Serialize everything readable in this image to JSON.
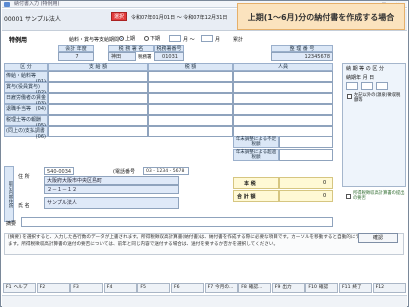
{
  "window": {
    "title": "納付書入力 (特例用)",
    "controls": "－ □ ×"
  },
  "header": {
    "company_name": "00001 サンプル法人",
    "change_button": "選択",
    "period_start": "令和07年01月01日",
    "period_sep": "～",
    "period_end": "令和07年12月31日",
    "banner": "上期(1～6月)分の納付書を作成する場合"
  },
  "section_title": "特例用",
  "pay_period": {
    "label": "給料・賞与等支給期間",
    "opt1": "上期",
    "opt2": "下期",
    "from_sep": "月 ～",
    "to_suffix": "月",
    "total": "累計"
  },
  "top_grid": {
    "tax_year_label": "会計 年度",
    "tax_year_value": "7",
    "office_label": "税 務 署 名",
    "office_num_label": "税務署番号",
    "office_value": "神田",
    "office_sub": "税務署",
    "office_num": "01031",
    "org_num_label": "整 理 番 号",
    "org_num": "12345678",
    "kubun": "区 分",
    "col_shikyu": "支 給 額",
    "col_zei": "税 額",
    "col_jinin": "人員"
  },
  "rows": [
    {
      "label": "俸給・給料等",
      "code": "(01)"
    },
    {
      "label": "賞与(役員賞与)",
      "code": "(02)"
    },
    {
      "label": "日雇労働者の賃金",
      "code": "(03)"
    },
    {
      "label": "退職手当等",
      "code": "(04)"
    },
    {
      "label": "税理士等の報酬",
      "code": "(05)"
    },
    {
      "label": "(同上の)支払調書",
      "code": "(06)"
    }
  ],
  "right_panel": {
    "period_title": "納 期 等 の 区 分",
    "period_label": "納期年 月 日",
    "deadline_text": "提出年月 日",
    "check_label": "左記以外の(源泉)徴収税額等",
    "yearend_adj": "年末調整による不足税額",
    "yearend_over": "年末調整による超過税額",
    "honzei": "本 税",
    "tax_total": "税",
    "grand_total": "合 計 額",
    "tax_total_value": "0",
    "grand_total_value": "0",
    "footer_note": "所得税徴収高計算書の提出の要否",
    "yen": "円"
  },
  "address": {
    "label_jusho": "住 所",
    "zip": "540-0034",
    "phone_label": "(電話番号",
    "phone": "03 - 1234 - 5678",
    "line1": "大阪府大阪市中央区島町",
    "line2": "２－１－１２",
    "name_label": "氏 名",
    "name": "サンプル法人",
    "side_label": "取引内容住所"
  },
  "remarks_label": "摘要",
  "message": "[摘要] を選択すると、入力した各行数のデータが上書されます。所得税徴収高計算書(納付書)は、納付書を作成する際に必要な項目です。カーソルを移動すると自動的にデータが取り込まれます。所得税徴収高計算書の送付の要否については、前年と同じ内容で送付する場合は、送付を要するか否かを選択してください。",
  "confirm_button": "確認",
  "fkeys": [
    {
      "key": "F1",
      "label": "ヘルプ"
    },
    {
      "key": "F2",
      "label": ""
    },
    {
      "key": "F3",
      "label": ""
    },
    {
      "key": "F4",
      "label": ""
    },
    {
      "key": "F5",
      "label": ""
    },
    {
      "key": "F6",
      "label": ""
    },
    {
      "key": "F7",
      "label": "今月の..."
    },
    {
      "key": "F8",
      "label": "確認..."
    },
    {
      "key": "F9",
      "label": "出力"
    },
    {
      "key": "F10",
      "label": "確認"
    },
    {
      "key": "F11",
      "label": "終了"
    },
    {
      "key": "F12",
      "label": ""
    }
  ]
}
